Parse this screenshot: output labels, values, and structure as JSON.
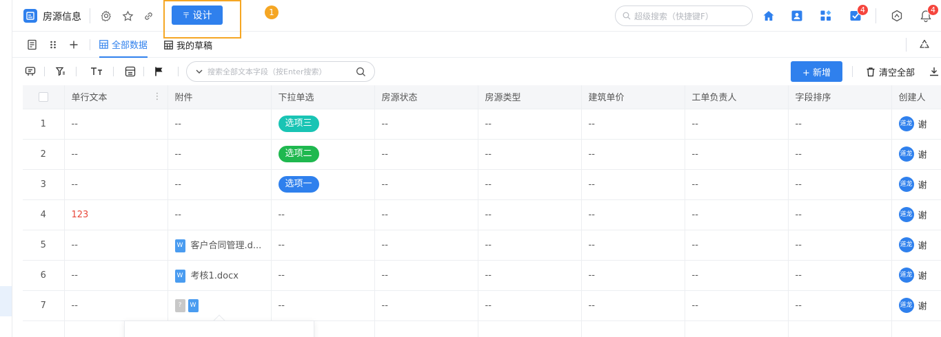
{
  "app": {
    "title": "房源信息"
  },
  "design_button": {
    "prefix": "〒",
    "label": "设计"
  },
  "step_badge": "1",
  "search_top": {
    "placeholder": "超级搜索（快捷键F）"
  },
  "notifications": {
    "tasks_count": "4",
    "bell_count": "4"
  },
  "tabs": [
    {
      "label": "全部数据",
      "active": true
    },
    {
      "label": "我的草稿",
      "active": false
    }
  ],
  "toolbar": {
    "search_placeholder": "搜索全部文本字段（按Enter搜索）",
    "add_label": "+ 新增",
    "clear_label": "清空全部"
  },
  "table": {
    "columns": [
      "单行文本",
      "附件",
      "下拉单选",
      "房源状态",
      "房源类型",
      "建筑单价",
      "工单负责人",
      "字段排序",
      "创建人"
    ],
    "rows": [
      {
        "index": "1",
        "text": "--",
        "attachment": "--",
        "select": "选项三",
        "select_color": "#19c4b4",
        "status": "--",
        "type": "--",
        "price": "--",
        "owner": "--",
        "order": "--",
        "creator_avatar": "道龙",
        "creator": "谢"
      },
      {
        "index": "2",
        "text": "--",
        "attachment": "--",
        "select": "选项二",
        "select_color": "#1fb84f",
        "status": "--",
        "type": "--",
        "price": "--",
        "owner": "--",
        "order": "--",
        "creator_avatar": "道龙",
        "creator": "谢"
      },
      {
        "index": "3",
        "text": "--",
        "attachment": "--",
        "select": "选项一",
        "select_color": "#2f80ed",
        "status": "--",
        "type": "--",
        "price": "--",
        "owner": "--",
        "order": "--",
        "creator_avatar": "道龙",
        "creator": "谢"
      },
      {
        "index": "4",
        "text": "123",
        "attachment": "--",
        "select": "--",
        "select_color": "",
        "status": "--",
        "type": "--",
        "price": "--",
        "owner": "--",
        "order": "--",
        "creator_avatar": "道龙",
        "creator": "谢"
      },
      {
        "index": "5",
        "text": "--",
        "attachment": "客户合同管理.d...",
        "attachment_icon": "W",
        "select": "--",
        "select_color": "",
        "status": "--",
        "type": "--",
        "price": "--",
        "owner": "--",
        "order": "--",
        "creator_avatar": "道龙",
        "creator": "谢"
      },
      {
        "index": "6",
        "text": "--",
        "attachment": "考核1.docx",
        "attachment_icon": "W",
        "select": "--",
        "select_color": "",
        "status": "--",
        "type": "--",
        "price": "--",
        "owner": "--",
        "order": "--",
        "creator_avatar": "道龙",
        "creator": "谢"
      },
      {
        "index": "7",
        "text": "--",
        "attachment": "",
        "attachment_icons": [
          "?",
          "W"
        ],
        "select": "--",
        "select_color": "",
        "status": "--",
        "type": "--",
        "price": "--",
        "owner": "--",
        "order": "--",
        "creator_avatar": "道龙",
        "creator": "谢"
      }
    ]
  },
  "colors": {
    "accent": "#2f80ed",
    "highlight": "#f5a623",
    "badge": "#f5453d"
  }
}
